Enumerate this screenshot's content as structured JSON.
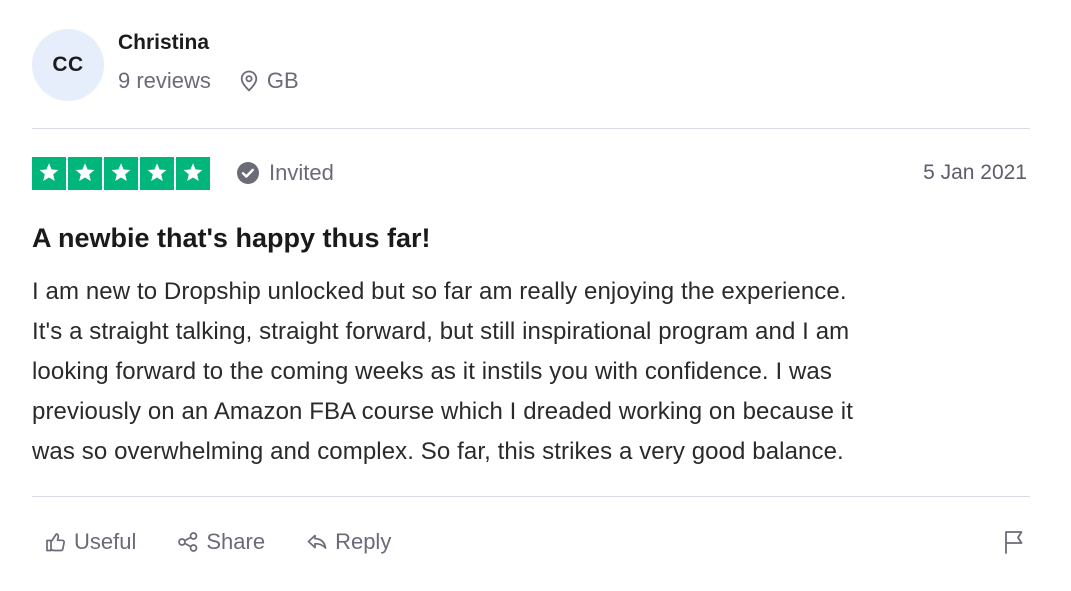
{
  "consumer": {
    "initials": "CC",
    "name": "Christina",
    "reviews_count": "9 reviews",
    "location": "GB",
    "avatar_bg": "#e5eefa"
  },
  "review": {
    "stars": 5,
    "star_color": "#00b67a",
    "status_label": "Invited",
    "date": "5 Jan 2021",
    "title": "A newbie that's happy thus far!",
    "body_lines": [
      "I am new to Dropship unlocked but so far am really enjoying the experience.",
      "It's a straight talking, straight forward, but still inspirational program and I am",
      "looking forward to the coming weeks as it instils you with confidence. I was",
      "previously on an Amazon FBA course which I dreaded working on because it",
      "was so overwhelming and complex. So far, this strikes a very good balance."
    ]
  },
  "actions": {
    "useful_label": "Useful",
    "share_label": "Share",
    "reply_label": "Reply"
  },
  "icons": {
    "location": "map-pin-icon",
    "verified": "check-circle-icon",
    "useful": "thumbs-up-icon",
    "share": "share-icon",
    "reply": "reply-icon",
    "flag": "flag-icon"
  }
}
